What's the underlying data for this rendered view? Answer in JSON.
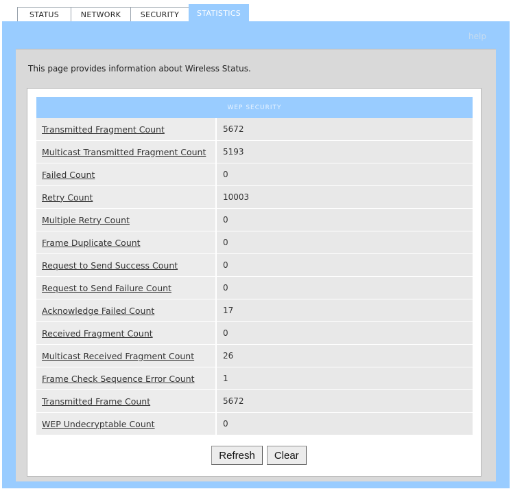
{
  "tabs": [
    {
      "label": "STATUS"
    },
    {
      "label": "NETWORK"
    },
    {
      "label": "SECURITY"
    },
    {
      "label": "STATISTICS"
    }
  ],
  "help_label": "help",
  "intro_text": "This page provides information about Wireless Status.",
  "section_title": "WEP SECURITY",
  "stats": [
    {
      "label": "Transmitted Fragment Count",
      "value": "5672"
    },
    {
      "label": "Multicast Transmitted Fragment Count",
      "value": "5193"
    },
    {
      "label": "Failed Count",
      "value": "0"
    },
    {
      "label": "Retry Count",
      "value": "10003"
    },
    {
      "label": "Multiple Retry Count",
      "value": "0"
    },
    {
      "label": "Frame Duplicate Count",
      "value": "0"
    },
    {
      "label": "Request to Send Success Count",
      "value": "0"
    },
    {
      "label": "Request to Send Failure Count",
      "value": "0"
    },
    {
      "label": "Acknowledge Failed Count",
      "value": "17"
    },
    {
      "label": "Received Fragment Count",
      "value": "0"
    },
    {
      "label": "Multicast Received Fragment Count",
      "value": "26"
    },
    {
      "label": "Frame Check Sequence Error Count",
      "value": "1"
    },
    {
      "label": "Transmitted Frame Count",
      "value": "5672"
    },
    {
      "label": "WEP Undecryptable Count",
      "value": "0"
    }
  ],
  "buttons": {
    "refresh": "Refresh",
    "clear": "Clear"
  },
  "colors": {
    "accent": "#99ccff",
    "panel": "#d9d9d9"
  }
}
